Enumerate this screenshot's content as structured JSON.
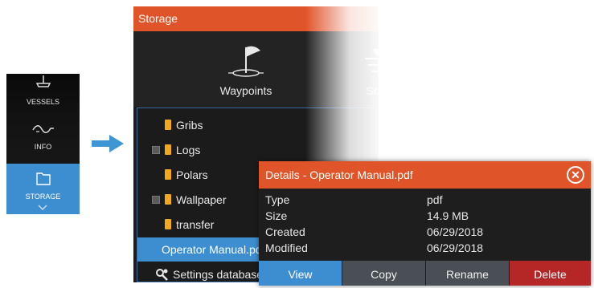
{
  "side_menu": {
    "items": [
      {
        "label": "VESSELS",
        "icon": "vessel-icon"
      },
      {
        "label": "INFO",
        "icon": "waveform-icon"
      },
      {
        "label": "STORAGE",
        "icon": "folder-icon",
        "selected": true
      }
    ]
  },
  "colors": {
    "title_bar": "#e0542a",
    "selection": "#3d8dd1",
    "folder": "#f0a81c",
    "delete": "#b52626"
  },
  "storage": {
    "title": "Storage",
    "quick_items": [
      {
        "label": "Waypoints",
        "icon": "waypoint-flag-icon"
      },
      {
        "label": "Sonar",
        "icon": "sonar-icon"
      }
    ],
    "files": [
      {
        "name": "Gribs",
        "type": "folder",
        "expandable": false
      },
      {
        "name": "Logs",
        "type": "folder",
        "expandable": true
      },
      {
        "name": "Polars",
        "type": "folder",
        "expandable": false
      },
      {
        "name": "Wallpaper",
        "type": "folder",
        "expandable": true
      },
      {
        "name": "transfer",
        "type": "folder",
        "expandable": false
      },
      {
        "name": "Operator Manual.pdf",
        "type": "file",
        "selected": true
      },
      {
        "name": "Settings database",
        "type": "settings"
      }
    ]
  },
  "details": {
    "title": "Details - Operator Manual.pdf",
    "rows": [
      {
        "key": "Type",
        "value": "pdf"
      },
      {
        "key": "Size",
        "value": "14.9 MB"
      },
      {
        "key": "Created",
        "value": "06/29/2018"
      },
      {
        "key": "Modified",
        "value": "06/29/2018"
      }
    ],
    "actions": {
      "view": "View",
      "copy": "Copy",
      "rename": "Rename",
      "delete": "Delete"
    }
  }
}
